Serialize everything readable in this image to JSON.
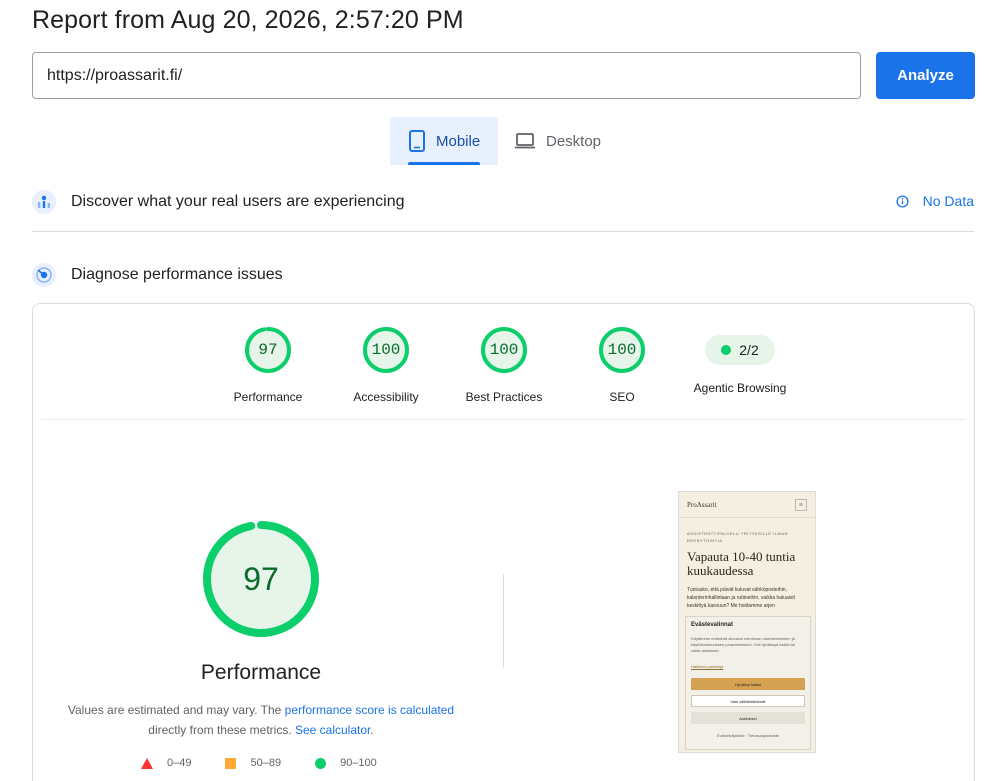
{
  "header": {
    "title": "Report from Aug 20, 2026, 2:57:20 PM"
  },
  "search": {
    "url_value": "https://proassarit.fi/",
    "analyze_label": "Analyze"
  },
  "device_tabs": {
    "mobile_label": "Mobile",
    "desktop_label": "Desktop",
    "selected": "Mobile"
  },
  "field_data": {
    "title": "Discover what your real users are experiencing",
    "status": "No Data"
  },
  "lab_data": {
    "title": "Diagnose performance issues"
  },
  "scores": [
    {
      "label": "Performance",
      "value": "97",
      "fraction": 0.97
    },
    {
      "label": "Accessibility",
      "value": "100",
      "fraction": 1.0
    },
    {
      "label": "Best Practices",
      "value": "100",
      "fraction": 1.0
    },
    {
      "label": "SEO",
      "value": "100",
      "fraction": 1.0
    }
  ],
  "agentic": {
    "label": "Agentic Browsing",
    "value": "2/2"
  },
  "performance_detail": {
    "score": "97",
    "fraction": 0.97,
    "label": "Performance",
    "note_prefix": "Values are estimated and may vary. The ",
    "note_link": "performance score is calculated",
    "note_middle": "directly from these metrics. ",
    "note_link2": "See calculator",
    "note_suffix": "."
  },
  "legend": [
    {
      "range": "0–49",
      "color": "#ff3333",
      "shape": "triangle"
    },
    {
      "range": "50–89",
      "color": "#ffaa33",
      "shape": "square"
    },
    {
      "range": "90–100",
      "color": "#0cce6b",
      "shape": "circle"
    }
  ],
  "colors": {
    "accent": "#1a73e8",
    "pass": "#0cce6b",
    "pass_text": "#0b6b2b",
    "pass_bg": "#e6f4ea"
  },
  "screenshot": {
    "logo": "ProAssarit",
    "kicker": "ASSISTENTTIPALVELU YRITYKSILLE ILMAN REKRYTOINTIA",
    "hero": "Vapauta 10-40 tuntia kuukaudessa",
    "body": "Tuntuuko, että päivät kuluvat sähköposteihin, kalenterinhallintaan ja rutiineihin, vaikka haluaisit keskittyä kasvuun? Me hoidamme arjen",
    "cookie_title": "Evästevalinnat",
    "cookie_text": "Käytämme evästeitä sivuston toiminnan varmistamiseen ja käyttökokemuksen parantamiseen. Voit hyväksyä kaikki tai valita asetukset.",
    "cookie_link": "Hallinnoi palveluja",
    "accept_label": "Hyväksy kaikki",
    "select_label": "Vain välttämättömät",
    "settings_label": "Asetukset",
    "footer_links": "Evästekäytäntö · Tietosuojaseloste"
  }
}
